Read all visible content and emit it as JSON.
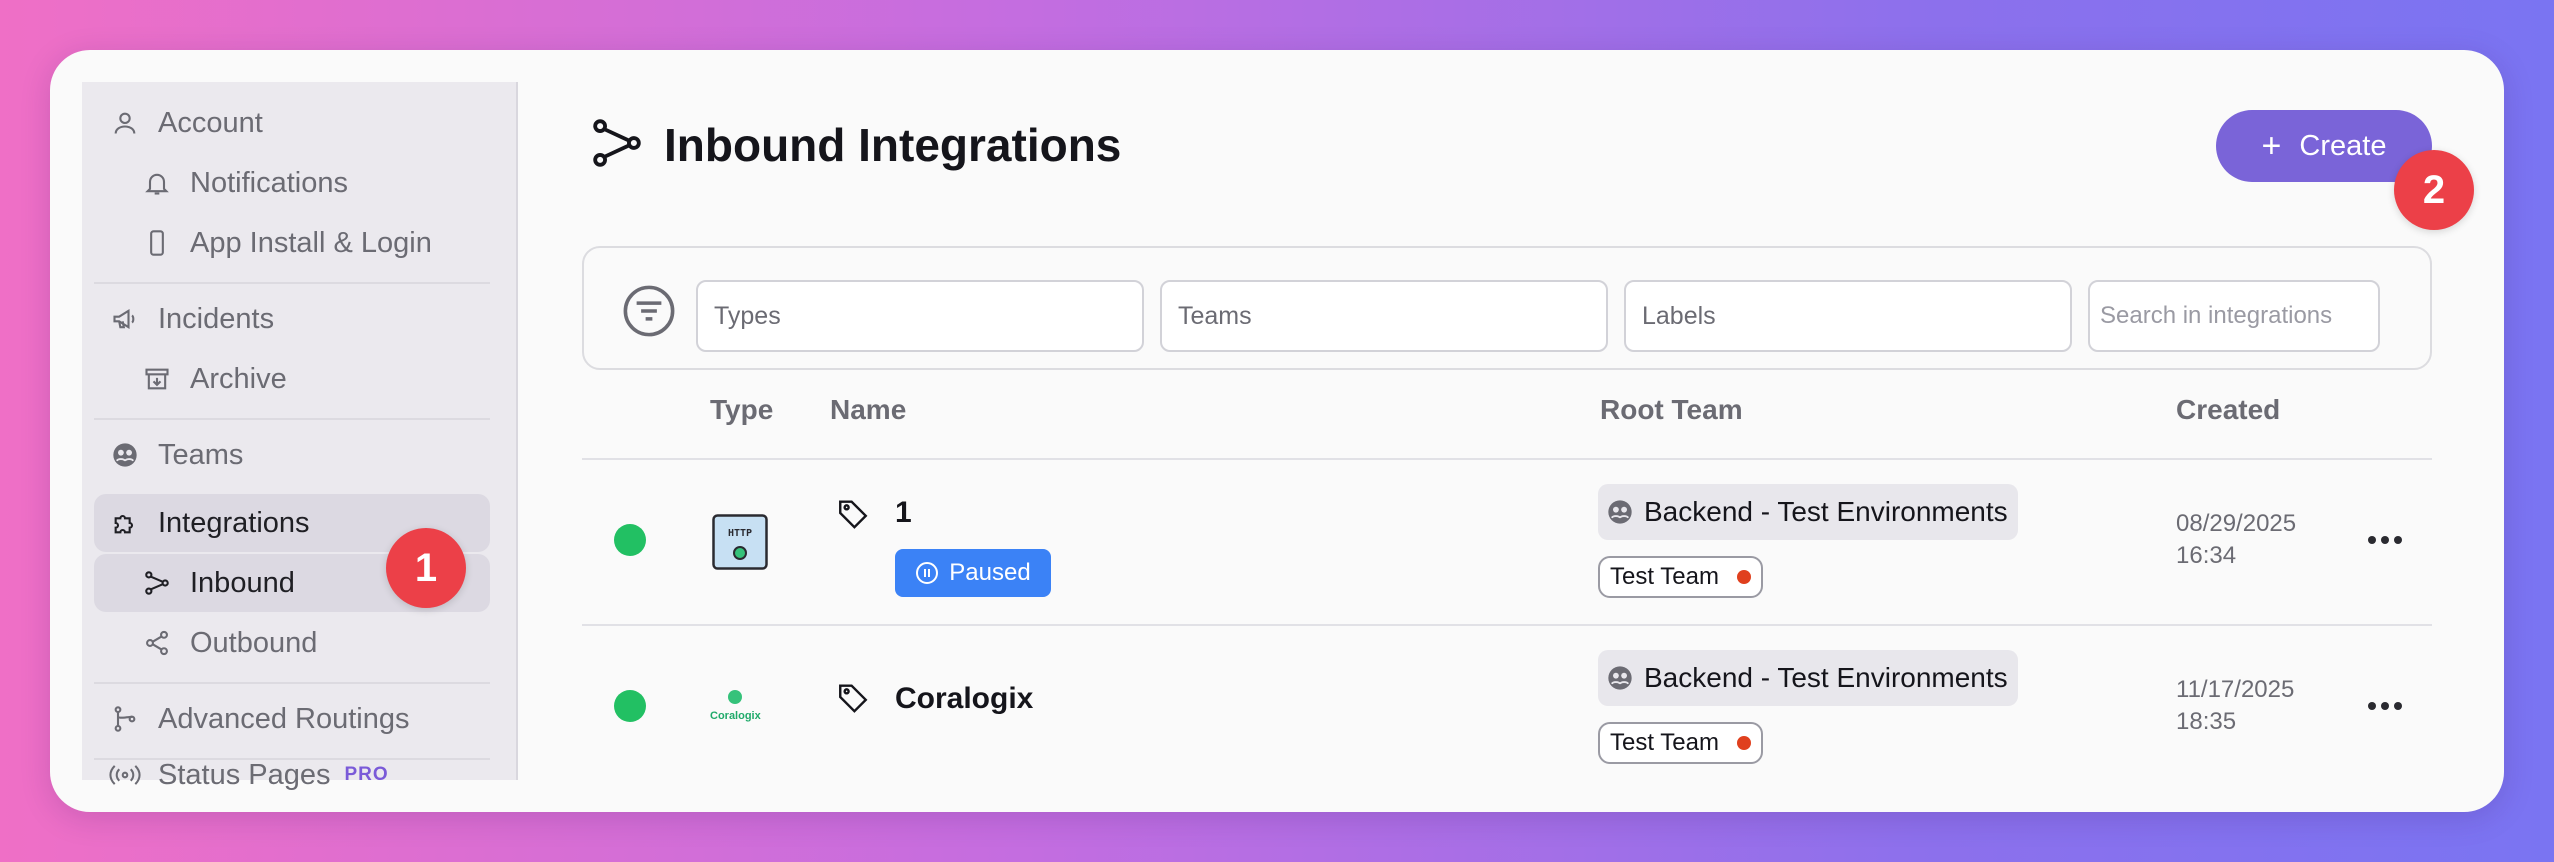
{
  "sidebar": {
    "items": [
      {
        "label": "Account",
        "icon": "user-icon"
      },
      {
        "label": "Notifications",
        "icon": "bell-icon"
      },
      {
        "label": "App Install & Login",
        "icon": "phone-icon"
      },
      {
        "label": "Incidents",
        "icon": "megaphone-icon"
      },
      {
        "label": "Archive",
        "icon": "archive-icon"
      },
      {
        "label": "Teams",
        "icon": "team-icon"
      },
      {
        "label": "Integrations",
        "icon": "puzzle-icon"
      },
      {
        "label": "Inbound",
        "icon": "inbound-icon"
      },
      {
        "label": "Outbound",
        "icon": "share-icon"
      },
      {
        "label": "Advanced Routings",
        "icon": "branch-icon"
      },
      {
        "label": "Status Pages",
        "icon": "broadcast-icon",
        "badge": "PRO"
      }
    ]
  },
  "markers": {
    "one": "1",
    "two": "2"
  },
  "header": {
    "title": "Inbound Integrations",
    "create_label": "Create"
  },
  "filters": {
    "types_placeholder": "Types",
    "teams_placeholder": "Teams",
    "labels_placeholder": "Labels",
    "search_placeholder": "Search in integrations"
  },
  "table": {
    "columns": {
      "type": "Type",
      "name": "Name",
      "root_team": "Root Team",
      "created": "Created"
    },
    "rows": [
      {
        "status_color": "#22c063",
        "type_icon": "http-icon",
        "type_text": "HTTP",
        "name": "1",
        "badge": "Paused",
        "root_team": "Backend - Test Environments",
        "team": "Test Team",
        "created_date": "08/29/2025",
        "created_time": "16:34"
      },
      {
        "status_color": "#22c063",
        "type_icon": "coralogix-icon",
        "type_text": "Coralogix",
        "name": "Coralogix",
        "root_team": "Backend - Test Environments",
        "team": "Test Team",
        "created_date": "11/17/2025",
        "created_time": "18:35"
      }
    ]
  },
  "colors": {
    "accent": "#7a64d8",
    "paused": "#3b82f6",
    "status_ok": "#22c063",
    "marker": "#ec4048"
  }
}
